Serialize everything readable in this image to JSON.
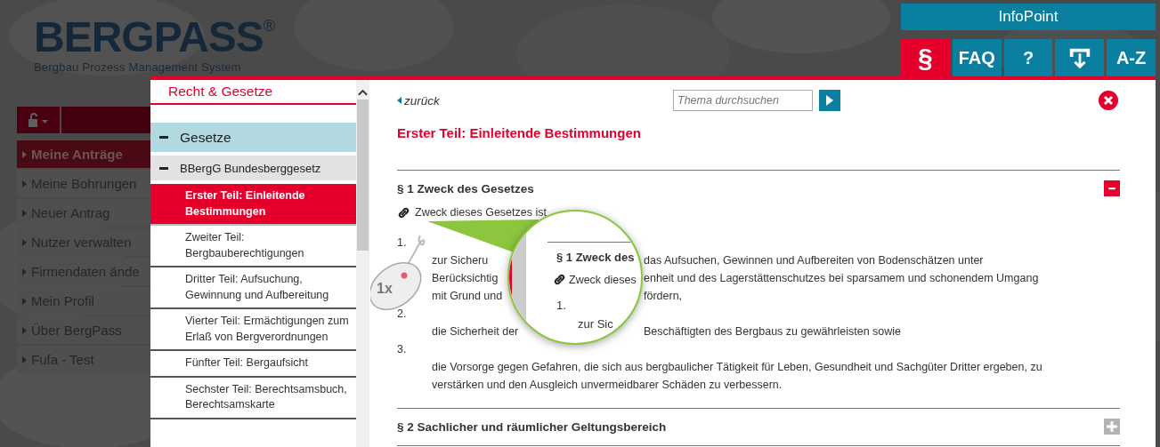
{
  "logo": {
    "wordmark": "BERGPASS",
    "registered": "®",
    "tagline": "Bergbau Prozess Management System"
  },
  "nav": {
    "items": [
      {
        "label": "Meine Anträge",
        "selected": true
      },
      {
        "label": "Meine Bohrungen",
        "selected": false
      },
      {
        "label": "Neuer Antrag",
        "selected": false
      },
      {
        "label": "Nutzer verwalten",
        "selected": false
      },
      {
        "label": "Firmendaten ände",
        "selected": false
      },
      {
        "label": "Mein Profil",
        "selected": false
      },
      {
        "label": "Über BergPass",
        "selected": false
      },
      {
        "label": "Fufa - Test",
        "selected": false
      }
    ]
  },
  "infopoint": {
    "title": "InfoPoint",
    "tabs": [
      {
        "kind": "text",
        "label": "§",
        "selected": true
      },
      {
        "kind": "text",
        "label": "FAQ",
        "selected": false
      },
      {
        "kind": "text",
        "label": "?",
        "selected": false
      },
      {
        "kind": "download",
        "selected": false
      },
      {
        "kind": "text",
        "label": "A-Z",
        "selected": false
      }
    ]
  },
  "sidebar": {
    "title": "Recht & Gesetze",
    "tree": [
      {
        "label": "Gesetze",
        "expanded": true,
        "children": [
          {
            "label": "BBergG Bundesberggesetz",
            "expanded": true,
            "children": [
              {
                "label": "Erster Teil: Einleitende Bestimmungen",
                "selected": true
              },
              {
                "label": "Zweiter Teil: Bergbauberechtigungen",
                "selected": false
              },
              {
                "label": "Dritter Teil: Aufsuchung, Gewinnung und Aufbereitung",
                "selected": false
              },
              {
                "label": "Vierter Teil: Ermächtigungen zum Erlaß von Bergverordnungen",
                "selected": false
              },
              {
                "label": "Fünfter Teil: Bergaufsicht",
                "selected": false
              },
              {
                "label": "Sechster Teil: Berechtsamsbuch, Berechtsamskarte",
                "selected": false
              }
            ]
          }
        ]
      }
    ]
  },
  "content": {
    "back_link": "zurück",
    "search": {
      "placeholder": "Thema durchsuchen"
    },
    "title": "Erster Teil: Einleitende Bestimmungen",
    "sections": [
      {
        "title": "§ 1 Zweck des Gesetzes",
        "expanded": true,
        "intro": "Zweck dieses Gesetzes ist",
        "items": [
          {
            "number": "1.",
            "lines": [
              [
                "zur Sicheru",
                "das Aufsuchen, Gewinnen und Aufbereiten von Bodenschätzen unter"
              ],
              [
                "Berücksichtig",
                "enheit und des Lagerstättenschutzes bei sparsamem und schonendem Umgang"
              ],
              [
                "mit Grund und",
                "fördern,"
              ]
            ]
          },
          {
            "number": "2.",
            "lines": [
              [
                "die Sicherheit der",
                "Beschäftigten des Bergbaus zu gewährleisten sowie"
              ]
            ]
          },
          {
            "number": "3.",
            "text": "die Vorsorge gegen Gefahren, die sich aus bergbaulicher Tätigkeit für Leben, Gesundheit und Sachgüter Dritter ergeben, zu verstärken und den Ausgleich unvermeidbarer Schäden zu verbessern."
          }
        ]
      },
      {
        "title": "§ 2 Sachlicher und räumlicher Geltungsbereich",
        "expanded": false
      }
    ]
  },
  "magnifier": {
    "section_title": "§ 1 Zweck des",
    "intro": "Zweck dieses",
    "item_number": "1.",
    "item_text": "zur Sic"
  },
  "cursor_badge": "1x"
}
